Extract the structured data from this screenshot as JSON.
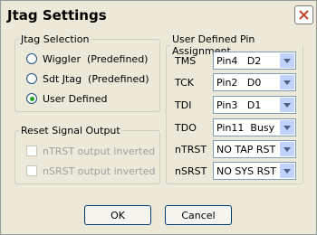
{
  "window": {
    "title": "Jtag Settings",
    "close_icon": "close-icon"
  },
  "jtag_selection": {
    "legend": "Jtag Selection",
    "options": [
      {
        "label": "Wiggler  (Predefined)",
        "selected": false
      },
      {
        "label": "Sdt Jtag  (Predefined)",
        "selected": false
      },
      {
        "label": "User Defined",
        "selected": true
      }
    ]
  },
  "reset_signal": {
    "legend": "Reset Signal Output",
    "options": [
      {
        "label": "nTRST output inverted",
        "checked": false,
        "enabled": false
      },
      {
        "label": "nSRST output inverted",
        "checked": false,
        "enabled": false
      }
    ]
  },
  "pin_assignment": {
    "legend": "User Defined Pin Assignment",
    "rows": [
      {
        "label": "TMS",
        "value": "Pin4   D2"
      },
      {
        "label": "TCK",
        "value": "Pin2   D0"
      },
      {
        "label": "TDI",
        "value": "Pin3   D1"
      },
      {
        "label": "TDO",
        "value": "Pin11  Busy"
      },
      {
        "label": "nTRST",
        "value": "NO TAP RST"
      },
      {
        "label": "nSRST",
        "value": "NO SYS RST"
      }
    ]
  },
  "buttons": {
    "ok": "OK",
    "cancel": "Cancel"
  }
}
